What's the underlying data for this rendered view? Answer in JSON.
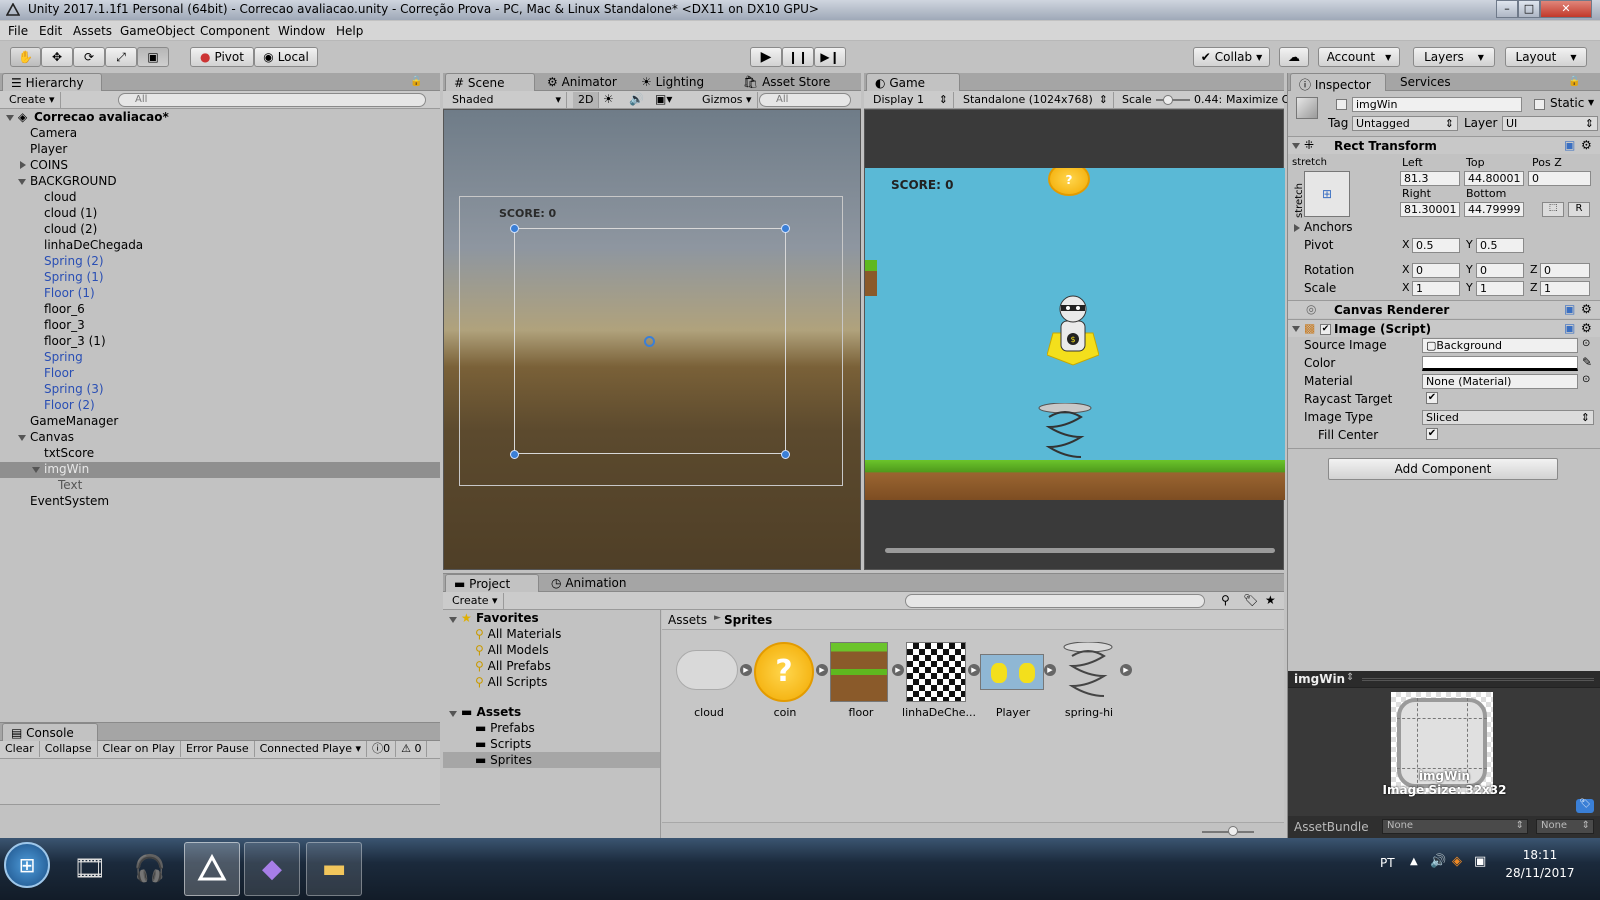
{
  "window": {
    "title": "Unity 2017.1.1f1 Personal (64bit) - Correcao avaliacao.unity - Correção Prova - PC, Mac & Linux Standalone* <DX11 on DX10 GPU>"
  },
  "menu": [
    "File",
    "Edit",
    "Assets",
    "GameObject",
    "Component",
    "Window",
    "Help"
  ],
  "toolbar": {
    "pivot": "Pivot",
    "local": "Local",
    "collab": "Collab",
    "account": "Account",
    "layers": "Layers",
    "layout": "Layout"
  },
  "hierarchy": {
    "tab": "Hierarchy",
    "create": "Create",
    "search": "All",
    "scene": "Correcao avaliacao*",
    "items": [
      {
        "label": "Camera"
      },
      {
        "label": "Player"
      },
      {
        "label": "COINS"
      },
      {
        "label": "BACKGROUND"
      },
      {
        "label": "cloud"
      },
      {
        "label": "cloud (1)"
      },
      {
        "label": "cloud (2)"
      },
      {
        "label": "linhaDeChegada"
      },
      {
        "label": "Spring (2)"
      },
      {
        "label": "Spring (1)"
      },
      {
        "label": "Floor (1)"
      },
      {
        "label": "floor_6"
      },
      {
        "label": "floor_3"
      },
      {
        "label": "floor_3 (1)"
      },
      {
        "label": "Spring"
      },
      {
        "label": "Floor"
      },
      {
        "label": "Spring (3)"
      },
      {
        "label": "Floor (2)"
      },
      {
        "label": "GameManager"
      },
      {
        "label": "Canvas"
      },
      {
        "label": "txtScore"
      },
      {
        "label": "imgWin"
      },
      {
        "label": "Text"
      },
      {
        "label": "EventSystem"
      }
    ]
  },
  "scene": {
    "tabs": [
      "Scene",
      "Animator",
      "Lighting",
      "Asset Store"
    ],
    "shading": "Shaded",
    "mode2d": "2D",
    "gizmos": "Gizmos",
    "search": "All",
    "score": "SCORE: 0"
  },
  "game": {
    "tab": "Game",
    "display": "Display 1",
    "resolution": "Standalone (1024x768)",
    "scale_label": "Scale",
    "scale_value": "0.44:",
    "maximize": "Maximize O",
    "score": "SCORE: 0",
    "scale_fraction": 0.35
  },
  "inspector": {
    "tabs": [
      "Inspector",
      "Services"
    ],
    "object_name": "imgWin",
    "static": "Static",
    "tag_label": "Tag",
    "tag": "Untagged",
    "layer_label": "Layer",
    "layer": "UI",
    "rect_transform": {
      "title": "Rect Transform",
      "stretch": "stretch",
      "left_label": "Left",
      "left": "81.3",
      "top_label": "Top",
      "top": "44.80001",
      "posz_label": "Pos Z",
      "posz": "0",
      "right_label": "Right",
      "right": "81.30001",
      "bottom_label": "Bottom",
      "bottom": "44.79999",
      "anchors": "Anchors",
      "pivot_label": "Pivot",
      "pivot_x": "0.5",
      "pivot_y": "0.5",
      "rotation_label": "Rotation",
      "rot_x": "0",
      "rot_y": "0",
      "rot_z": "0",
      "scale_label": "Scale",
      "scale_x": "1",
      "scale_y": "1",
      "scale_z": "1",
      "r": "R"
    },
    "canvas_renderer": "Canvas Renderer",
    "image_script": {
      "title": "Image (Script)",
      "source_image_label": "Source Image",
      "source_image": "Background",
      "color_label": "Color",
      "material_label": "Material",
      "material": "None (Material)",
      "raycast_label": "Raycast Target",
      "image_type_label": "Image Type",
      "image_type": "Sliced",
      "fill_center_label": "Fill Center"
    },
    "add_component": "Add Component",
    "preview": {
      "title": "imgWin",
      "name": "imgWin",
      "size": "Image Size: 32x32"
    },
    "assetbundle_label": "AssetBundle",
    "assetbundle": "None",
    "assetbundle_variant": "None"
  },
  "project": {
    "tabs": [
      "Project",
      "Animation"
    ],
    "create": "Create",
    "favorites": "Favorites",
    "fav_items": [
      "All Materials",
      "All Models",
      "All Prefabs",
      "All Scripts"
    ],
    "assets": "Assets",
    "folders": [
      "Prefabs",
      "Scripts",
      "Sprites"
    ],
    "breadcrumb": [
      "Assets",
      "Sprites"
    ],
    "sprites": [
      "cloud",
      "coin",
      "floor",
      "linhaDeChe...",
      "Player",
      "spring-hi"
    ]
  },
  "console": {
    "tab": "Console",
    "buttons": [
      "Clear",
      "Collapse",
      "Clear on Play",
      "Error Pause",
      "Connected Playe"
    ],
    "errors": "0",
    "warnings": "0"
  },
  "taskbar": {
    "lang": "PT",
    "time": "18:11",
    "date": "28/11/2017"
  }
}
